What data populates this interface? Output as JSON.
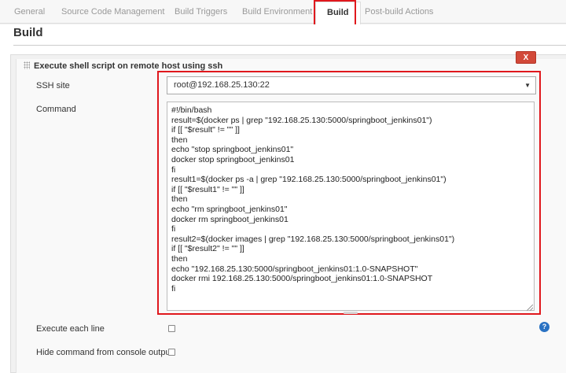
{
  "tabs": [
    {
      "label": "General"
    },
    {
      "label": "Source Code Management"
    },
    {
      "label": "Build Triggers"
    },
    {
      "label": "Build Environment"
    },
    {
      "label": "Build"
    },
    {
      "label": "Post-build Actions"
    }
  ],
  "section": {
    "title": "Build"
  },
  "step": {
    "title": "Execute shell script on remote host using ssh",
    "delete_label": "X"
  },
  "fields": {
    "ssh_site_label": "SSH site",
    "ssh_site_value": "root@192.168.25.130:22",
    "command_label": "Command",
    "execute_each_line_label": "Execute each line",
    "hide_command_label": "Hide command from console output"
  },
  "command_lines": [
    "#!/bin/bash",
    "result=$(docker ps | grep \"192.168.25.130:5000/springboot_jenkins01\")",
    "if [[ \"$result\" != \"\" ]]",
    "then",
    "echo \"stop springboot_jenkins01\"",
    "docker stop springboot_jenkins01",
    "fi",
    "result1=$(docker ps -a | grep \"192.168.25.130:5000/springboot_jenkins01\")",
    "if [[ \"$result1\" != \"\" ]]",
    "then",
    "echo \"rm springboot_jenkins01\"",
    "docker rm springboot_jenkins01",
    "fi",
    "result2=$(docker images | grep \"192.168.25.130:5000/springboot_jenkins01\")",
    "if [[ \"$result2\" != \"\" ]]",
    "then",
    "echo \"192.168.25.130:5000/springboot_jenkins01:1.0-SNAPSHOT\"",
    "docker rmi 192.168.25.130:5000/springboot_jenkins01:1.0-SNAPSHOT",
    "fi"
  ],
  "icons": {
    "help": "?",
    "dropdown": "▼"
  }
}
